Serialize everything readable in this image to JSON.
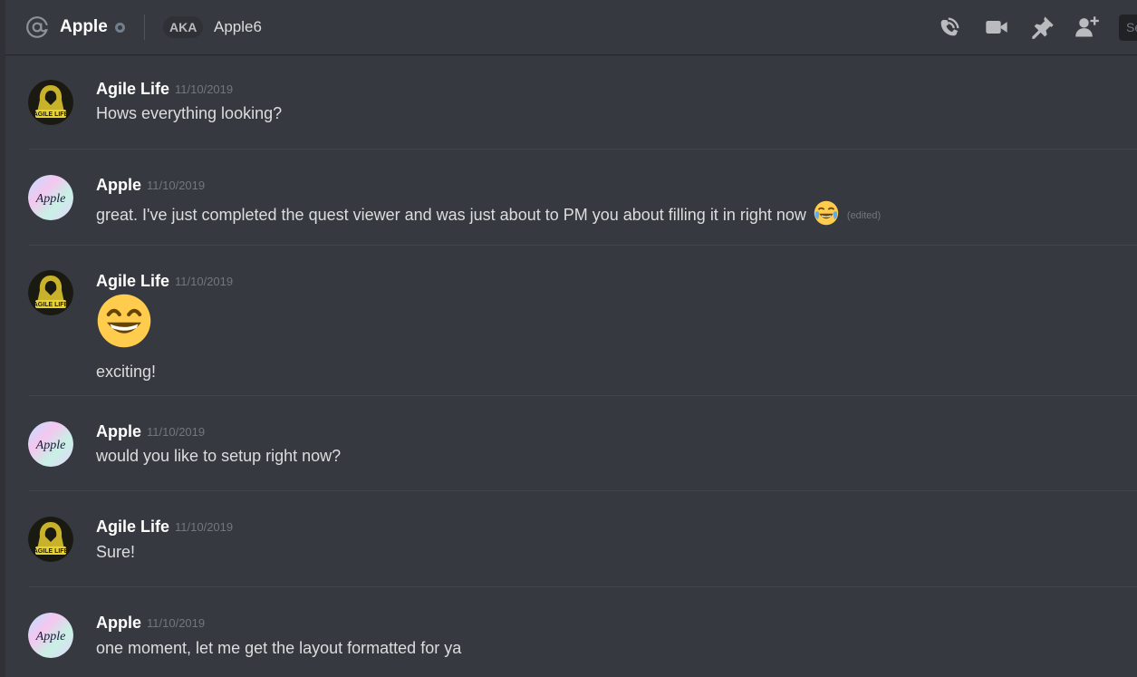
{
  "header": {
    "channel_name": "Apple",
    "aka_label": "AKA",
    "aka_name": "Apple6",
    "search_placeholder": "Search",
    "icons": [
      "at-icon",
      "start-voice-call-icon",
      "start-video-call-icon",
      "pinned-messages-icon",
      "add-friend-icon"
    ]
  },
  "colors": {
    "background": "#36393f",
    "header_text": "#ffffff",
    "muted": "#72767d",
    "status_offline": "#747f8d"
  },
  "messages": [
    {
      "author": "Agile Life",
      "timestamp": "11/10/2019",
      "text": "Hows everything looking?",
      "avatar": "agile-life-avatar"
    },
    {
      "author": "Apple",
      "timestamp": "11/10/2019",
      "text": "great. I've just completed the quest viewer and was just about to PM you about filling it in right now",
      "emoji": "joy-emoji",
      "edited": "(edited)",
      "avatar": "apple-avatar"
    },
    {
      "author": "Agile Life",
      "timestamp": "11/10/2019",
      "big_emoji": "smile-emoji",
      "text": "exciting!",
      "avatar": "agile-life-avatar"
    },
    {
      "author": "Apple",
      "timestamp": "11/10/2019",
      "text": "would you like to setup right now?",
      "avatar": "apple-avatar"
    },
    {
      "author": "Agile Life",
      "timestamp": "11/10/2019",
      "text": "Sure!",
      "avatar": "agile-life-avatar"
    },
    {
      "author": "Apple",
      "timestamp": "11/10/2019",
      "text": "one moment, let me get the layout formatted for ya",
      "avatar": "apple-avatar"
    }
  ],
  "avatar_text": {
    "agile_life": "AGILE LIFE",
    "apple": "Apple"
  }
}
